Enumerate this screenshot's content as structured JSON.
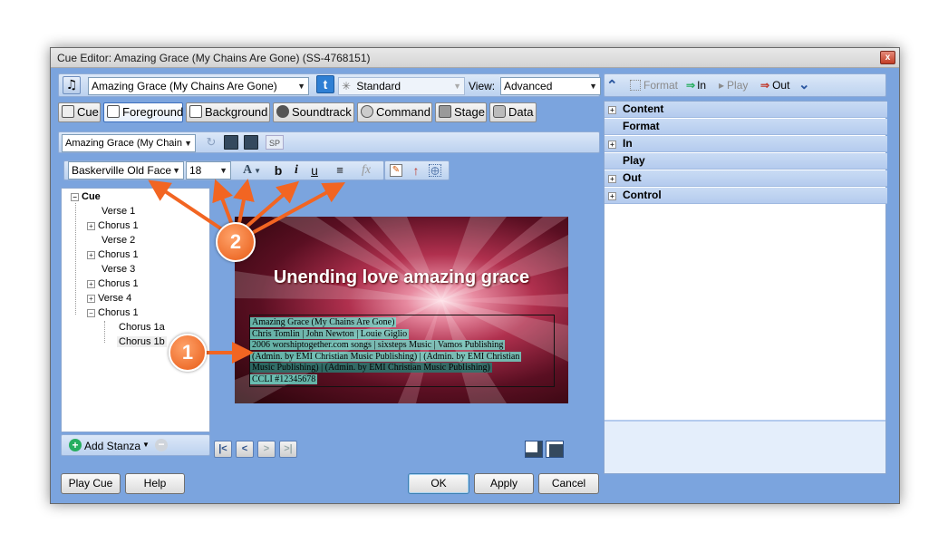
{
  "window": {
    "title": "Cue Editor: Amazing Grace (My Chains Are Gone) (SS-4768151)",
    "close_glyph": "x"
  },
  "top_toolbar": {
    "song_combo": "Amazing Grace (My Chains Are Gone)",
    "twitter_glyph": "t",
    "standard_combo": "Standard",
    "view_label": "View:",
    "view_combo": "Advanced"
  },
  "tabs": [
    {
      "label": "Cue",
      "active": false
    },
    {
      "label": "Foreground",
      "active": true
    },
    {
      "label": "Background",
      "active": false
    },
    {
      "label": "Soundtrack",
      "active": false
    },
    {
      "label": "Command",
      "active": false
    },
    {
      "label": "Stage",
      "active": false
    },
    {
      "label": "Data",
      "active": false
    }
  ],
  "stanza_toolbar": {
    "stanza_combo": "Amazing Grace (My Chains",
    "sp_label": "SP"
  },
  "format_toolbar": {
    "font_combo": "Baskerville Old Face",
    "size_combo": "18",
    "color_glyph": "A",
    "bold_glyph": "b",
    "italic_glyph": "i",
    "underline_glyph": "u",
    "fx_glyph": "fx"
  },
  "tree": {
    "root": "Cue",
    "items": [
      "Verse 1",
      "Chorus 1",
      "Verse 2",
      "Chorus 1",
      "Verse 3",
      "Chorus 1",
      "Verse 4",
      "Chorus 1",
      "Chorus 1a",
      "Chorus 1b"
    ],
    "add_stanza": "Add Stanza"
  },
  "preview": {
    "heading": "Unending love amazing grace",
    "lyrics": [
      "Amazing Grace (My Chains Are Gone)",
      "Chris Tomlin | John Newton | Louie Giglio",
      "2006 worshiptogether.com songs | sixsteps Music | Vamos Publishing",
      "(Admin. by EMI Christian Music Publishing) | (Admin. by EMI Christian",
      "Music Publishing) | (Admin. by EMI Christian Music Publishing)",
      "CCLI #12345678"
    ]
  },
  "callouts": {
    "one": "1",
    "two": "2"
  },
  "nav": {
    "first": "|<",
    "prev": "<",
    "next": ">",
    "last": ">|"
  },
  "right_panel": {
    "toolbar": {
      "format": "Format",
      "in": "In",
      "play": "Play",
      "out": "Out"
    },
    "sections": [
      {
        "label": "Content",
        "expandable": true
      },
      {
        "label": "Format",
        "expandable": false
      },
      {
        "label": "In",
        "expandable": true
      },
      {
        "label": "Play",
        "expandable": false
      },
      {
        "label": "Out",
        "expandable": true
      },
      {
        "label": "Control",
        "expandable": true
      }
    ]
  },
  "bottom_buttons": {
    "play_cue": "Play Cue",
    "help": "Help",
    "ok": "OK",
    "apply": "Apply",
    "cancel": "Cancel"
  },
  "colors": {
    "window_bg": "#7ba4de",
    "callout": "#f26522",
    "accent": "#3c6fbd"
  }
}
